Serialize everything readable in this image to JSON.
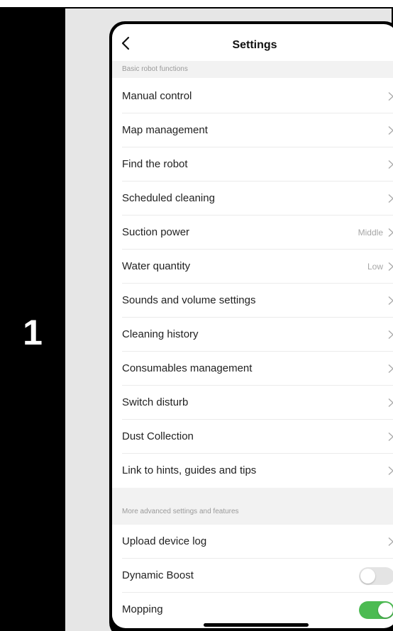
{
  "step": {
    "number": "1"
  },
  "header": {
    "title": "Settings"
  },
  "sections": [
    {
      "title": "Basic robot functions"
    },
    {
      "title": "More advanced settings and features"
    }
  ],
  "items": [
    {
      "label": "Manual control",
      "value": ""
    },
    {
      "label": "Map management",
      "value": ""
    },
    {
      "label": "Find the robot",
      "value": ""
    },
    {
      "label": "Scheduled cleaning",
      "value": ""
    },
    {
      "label": "Suction power",
      "value": "Middle"
    },
    {
      "label": "Water quantity",
      "value": "Low"
    },
    {
      "label": "Sounds and volume settings",
      "value": ""
    },
    {
      "label": "Cleaning history",
      "value": ""
    },
    {
      "label": "Consumables management",
      "value": ""
    },
    {
      "label": "Switch disturb",
      "value": ""
    },
    {
      "label": "Dust Collection",
      "value": ""
    },
    {
      "label": "Link to hints, guides and tips",
      "value": ""
    }
  ],
  "advanced_items": [
    {
      "label": "Upload device log",
      "type": "link"
    },
    {
      "label": "Dynamic Boost",
      "type": "toggle",
      "on": false
    },
    {
      "label": "Mopping",
      "type": "toggle",
      "on": true
    }
  ],
  "icons": {
    "back": "back-chevron-icon",
    "row": "chevron-right-icon"
  },
  "colors": {
    "toggle_on": "#4cbb52",
    "toggle_off": "#e4e4e4",
    "section_bg": "#f2f2f2",
    "step_bg": "#000000"
  }
}
